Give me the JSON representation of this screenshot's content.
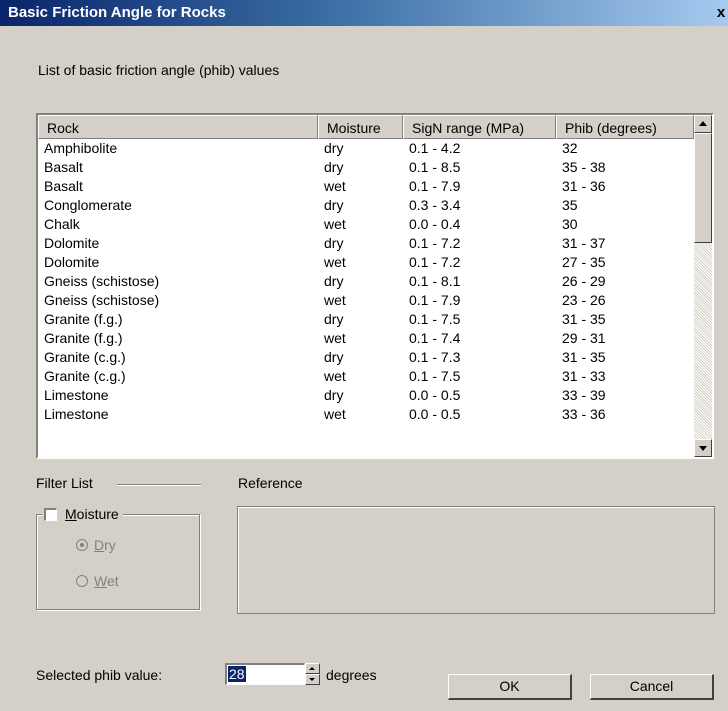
{
  "window": {
    "title": "Basic Friction Angle for Rocks",
    "close_label": "x"
  },
  "caption": "List of basic friction angle (phib) values",
  "table": {
    "columns": [
      "Rock",
      "Moisture",
      "SigN range (MPa)",
      "Phib (degrees)"
    ],
    "rows": [
      [
        "Amphibolite",
        "dry",
        "0.1 - 4.2",
        "32"
      ],
      [
        "Basalt",
        "dry",
        "0.1 - 8.5",
        "35 - 38"
      ],
      [
        "Basalt",
        "wet",
        "0.1 - 7.9",
        "31 - 36"
      ],
      [
        "Conglomerate",
        "dry",
        "0.3 - 3.4",
        "35"
      ],
      [
        "Chalk",
        "wet",
        "0.0 - 0.4",
        "30"
      ],
      [
        "Dolomite",
        "dry",
        "0.1 - 7.2",
        "31 - 37"
      ],
      [
        "Dolomite",
        "wet",
        "0.1 - 7.2",
        "27 - 35"
      ],
      [
        "Gneiss (schistose)",
        "dry",
        "0.1 - 8.1",
        "26 - 29"
      ],
      [
        "Gneiss (schistose)",
        "wet",
        "0.1 - 7.9",
        "23 - 26"
      ],
      [
        "Granite (f.g.)",
        "dry",
        "0.1 - 7.5",
        "31 - 35"
      ],
      [
        "Granite (f.g.)",
        "wet",
        "0.1 - 7.4",
        "29 - 31"
      ],
      [
        "Granite (c.g.)",
        "dry",
        "0.1 - 7.3",
        "31 - 35"
      ],
      [
        "Granite (c.g.)",
        "wet",
        "0.1 - 7.5",
        "31 - 33"
      ],
      [
        "Limestone",
        "dry",
        "0.0 - 0.5",
        "33 - 39"
      ],
      [
        "Limestone",
        "wet",
        "0.0 - 0.5",
        "33 - 36"
      ]
    ]
  },
  "filter": {
    "label": "Filter List",
    "moisture_label_accel": "M",
    "moisture_label_rest": "oisture",
    "moisture_checked": false,
    "dry_accel": "D",
    "dry_rest": "ry",
    "dry_selected": true,
    "wet_accel": "W",
    "wet_rest": "et",
    "wet_selected": false
  },
  "reference": {
    "label": "Reference",
    "text": ""
  },
  "selected": {
    "label": "Selected phib value:",
    "value": "28",
    "unit": "degrees"
  },
  "buttons": {
    "ok": "OK",
    "cancel": "Cancel"
  }
}
